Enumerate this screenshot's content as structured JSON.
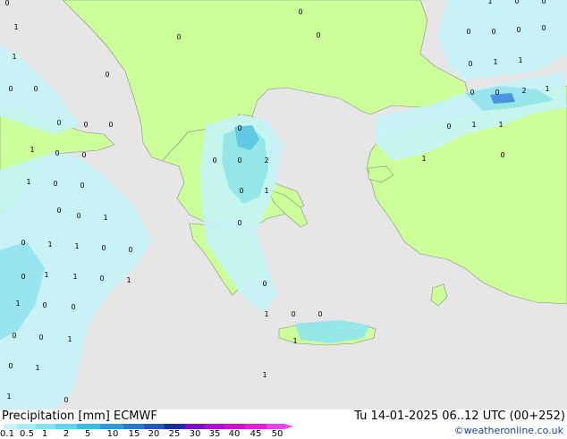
{
  "title": {
    "label": "Precipitation [mm]",
    "model": "ECMWF"
  },
  "run_info": "Tu 14-01-2025 06..12 UTC (00+252)",
  "credit": "©weatheronline.co.uk",
  "legend": {
    "ticks": [
      "0.1",
      "0.5",
      "1",
      "2",
      "5",
      "10",
      "15",
      "20",
      "25",
      "30",
      "35",
      "40",
      "45",
      "50"
    ],
    "colors": [
      "#c4f4f8",
      "#a6ecf4",
      "#86e2ee",
      "#60d4e8",
      "#40bce2",
      "#2e9ad8",
      "#2a78cc",
      "#2656b8",
      "#1a2ea0",
      "#7a10c0",
      "#a810cc",
      "#cc12cc",
      "#e020d8",
      "#e844e4"
    ]
  },
  "colors": {
    "sea": "#e6e6e6",
    "land": "#ccff99",
    "precip_light": "#c6f4f8",
    "precip_mid": "#90e4f0",
    "precip_heavy": "#56c4ec",
    "precip_strong": "#3a8ce0"
  },
  "map_labels": [
    "1",
    "1",
    "0",
    "0",
    "0",
    "0",
    "0",
    "1",
    "0",
    "0",
    "1",
    "0",
    "0",
    "1",
    "0",
    "0",
    "1",
    "1",
    "0",
    "0",
    "0",
    "1",
    "1",
    "0",
    "1",
    "1",
    "0",
    "0",
    "0",
    "0",
    "1",
    "0",
    "1",
    "1",
    "0",
    "0",
    "0",
    "2",
    "0",
    "0",
    "1",
    "0",
    "0",
    "1",
    "0",
    "0",
    "1",
    "1",
    "0",
    "0",
    "0",
    "0",
    "0",
    "1",
    "1",
    "0",
    "0",
    "2",
    "1",
    "1",
    "0",
    "1",
    "1",
    "0",
    "1",
    "0",
    "0",
    "0",
    "0",
    "0",
    "0",
    "0",
    "0"
  ]
}
